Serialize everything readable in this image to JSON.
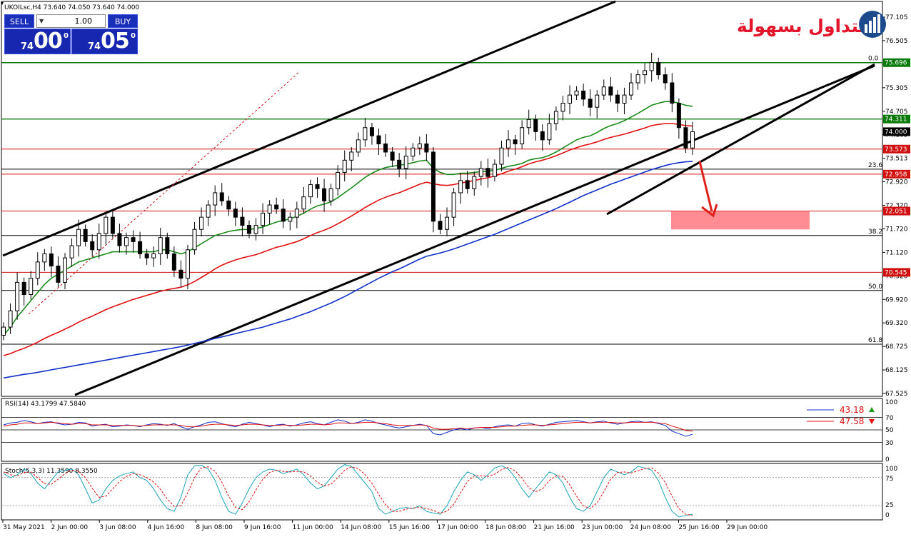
{
  "header": {
    "symbol_title": "UKOILsc,H4  73.640 74.050 73.640 74.000"
  },
  "trade_panel": {
    "sell_label": "SELL",
    "buy_label": "BUY",
    "lot_value": "1.00",
    "bid_small": "74",
    "bid_big": "00",
    "bid_sup": "0",
    "ask_small": "74",
    "ask_big": "05",
    "ask_sup": "0"
  },
  "logo": {
    "text": "التداول بسهولة"
  },
  "colors": {
    "bull_candle": "#ffffff",
    "bear_candle": "#000000",
    "ma_green": "#1a8a1a",
    "ma_red": "#e01010",
    "ma_blue": "#1030c8",
    "level_red": "#d01010",
    "level_green": "#0a7a0a",
    "target_zone": "#ff7f86",
    "arrow": "#e0201a"
  },
  "chart_data": [
    {
      "type": "candlestick",
      "title": "UKOILsc,H4  73.640 74.050 73.640 74.000",
      "ylim": [
        67.5,
        77.2
      ],
      "y_ticks": [
        "77.105",
        "76.505",
        "75.905",
        "75.305",
        "74.705",
        "74.105",
        "73.513",
        "72.920",
        "72.320",
        "71.720",
        "71.120",
        "70.520",
        "69.920",
        "69.320",
        "68.725",
        "68.125",
        "67.525"
      ],
      "x_ticks": [
        "31 May 2021",
        "2 Jun 00:00",
        "3 Jun 08:00",
        "4 Jun 16:00",
        "8 Jun 08:00",
        "9 Jun 16:00",
        "11 Jun 00:00",
        "14 Jun 08:00",
        "15 Jun 16:00",
        "17 Jun 00:00",
        "18 Jun 08:00",
        "21 Jun 16:00",
        "23 Jun 00:00",
        "24 Jun 08:00",
        "25 Jun 16:00",
        "29 Jun 00:00"
      ],
      "last_price": 74.0,
      "close": [
        69.2,
        69.6,
        70.3,
        70.0,
        70.4,
        70.8,
        71.0,
        70.7,
        70.3,
        70.9,
        71.2,
        71.6,
        71.3,
        71.1,
        71.5,
        71.9,
        71.5,
        71.2,
        71.4,
        71.3,
        71.0,
        70.9,
        71.0,
        71.4,
        71.0,
        70.6,
        70.4,
        71.1,
        71.6,
        71.9,
        72.2,
        72.5,
        72.3,
        72.1,
        71.9,
        71.7,
        71.5,
        71.7,
        72.0,
        72.2,
        72.1,
        71.8,
        71.9,
        72.1,
        72.4,
        72.7,
        72.6,
        72.3,
        72.6,
        73.0,
        73.3,
        73.5,
        73.8,
        74.1,
        73.9,
        73.7,
        73.5,
        73.3,
        73.1,
        73.4,
        73.6,
        73.7,
        73.5,
        71.8,
        71.6,
        71.9,
        72.5,
        72.8,
        72.6,
        72.9,
        73.1,
        72.9,
        73.2,
        73.6,
        73.8,
        73.7,
        74.1,
        74.3,
        74.0,
        73.8,
        74.2,
        74.5,
        74.7,
        74.9,
        75.0,
        74.8,
        74.6,
        74.9,
        75.1,
        74.9,
        74.7,
        74.9,
        75.2,
        75.4,
        75.5,
        75.7,
        75.4,
        75.2,
        74.7,
        74.1,
        73.6,
        74.0
      ],
      "series": [
        {
          "name": "",
          "role": "ma-green",
          "values": [
            69.0,
            69.2,
            69.45,
            69.65,
            69.85,
            70.05,
            70.25,
            70.4,
            70.5,
            70.6,
            70.7,
            70.8,
            70.85,
            70.9,
            70.95,
            71.0,
            71.05,
            71.05,
            71.05,
            71.05,
            71.05,
            71.05,
            71.05,
            71.1,
            71.1,
            71.05,
            71.0,
            71.05,
            71.15,
            71.25,
            71.35,
            71.45,
            71.5,
            71.55,
            71.58,
            71.6,
            71.6,
            71.62,
            71.66,
            71.72,
            71.78,
            71.82,
            71.86,
            71.92,
            72.0,
            72.1,
            72.18,
            72.22,
            72.28,
            72.38,
            72.5,
            72.62,
            72.75,
            72.88,
            72.98,
            73.06,
            73.12,
            73.15,
            73.18,
            73.2,
            73.24,
            73.28,
            73.3,
            73.1,
            73.0,
            72.95,
            72.95,
            72.98,
            72.98,
            73.0,
            73.02,
            73.03,
            73.05,
            73.1,
            73.15,
            73.18,
            73.22,
            73.3,
            73.34,
            73.36,
            73.42,
            73.5,
            73.6,
            73.7,
            73.8,
            73.86,
            73.9,
            73.98,
            74.08,
            74.15,
            74.2,
            74.27,
            74.36,
            74.45,
            74.55,
            74.65,
            74.7,
            74.74,
            74.74,
            74.7,
            74.65,
            74.62
          ]
        },
        {
          "name": "",
          "role": "ma-red",
          "values": [
            68.5,
            68.55,
            68.62,
            68.68,
            68.75,
            68.83,
            68.92,
            69.0,
            69.07,
            69.15,
            69.23,
            69.32,
            69.4,
            69.47,
            69.55,
            69.63,
            69.7,
            69.76,
            69.82,
            69.88,
            69.93,
            69.98,
            70.03,
            70.08,
            70.12,
            70.15,
            70.18,
            70.24,
            70.32,
            70.42,
            70.52,
            70.63,
            70.72,
            70.79,
            70.85,
            70.9,
            70.94,
            70.98,
            71.04,
            71.1,
            71.16,
            71.2,
            71.25,
            71.3,
            71.37,
            71.45,
            71.52,
            71.58,
            71.65,
            71.74,
            71.83,
            71.93,
            72.03,
            72.14,
            72.23,
            72.32,
            72.39,
            72.45,
            72.5,
            72.57,
            72.64,
            72.71,
            72.76,
            72.72,
            72.69,
            72.68,
            72.7,
            72.74,
            72.77,
            72.8,
            72.84,
            72.87,
            72.91,
            72.97,
            73.03,
            73.08,
            73.14,
            73.21,
            73.26,
            73.3,
            73.35,
            73.41,
            73.48,
            73.55,
            73.61,
            73.66,
            73.7,
            73.75,
            73.81,
            73.86,
            73.9,
            73.94,
            73.99,
            74.04,
            74.09,
            74.15,
            74.18,
            74.2,
            74.2,
            74.18,
            74.15,
            74.14
          ]
        },
        {
          "name": "",
          "role": "ma-blue",
          "values": [
            67.95,
            67.98,
            68.01,
            68.04,
            68.06,
            68.09,
            68.12,
            68.15,
            68.18,
            68.21,
            68.24,
            68.27,
            68.3,
            68.33,
            68.36,
            68.39,
            68.42,
            68.45,
            68.48,
            68.51,
            68.54,
            68.57,
            68.6,
            68.63,
            68.66,
            68.69,
            68.72,
            68.76,
            68.8,
            68.84,
            68.88,
            68.92,
            68.96,
            69.0,
            69.04,
            69.08,
            69.12,
            69.16,
            69.2,
            69.25,
            69.3,
            69.35,
            69.4,
            69.46,
            69.52,
            69.58,
            69.65,
            69.72,
            69.79,
            69.87,
            69.95,
            70.04,
            70.13,
            70.22,
            70.31,
            70.4,
            70.48,
            70.56,
            70.63,
            70.71,
            70.79,
            70.87,
            70.94,
            70.98,
            71.02,
            71.07,
            71.12,
            71.18,
            71.24,
            71.3,
            71.36,
            71.42,
            71.48,
            71.55,
            71.62,
            71.69,
            71.76,
            71.83,
            71.9,
            71.97,
            72.04,
            72.11,
            72.19,
            72.27,
            72.35,
            72.43,
            72.5,
            72.57,
            72.64,
            72.71,
            72.77,
            72.83,
            72.89,
            72.95,
            73.01,
            73.07,
            73.12,
            73.17,
            73.21,
            73.24,
            73.26,
            73.27
          ]
        }
      ],
      "horizontal_levels": [
        {
          "value": 75.696,
          "label": "75.696",
          "kind": "green-level"
        },
        {
          "value": 74.311,
          "label": "74.311",
          "kind": "green-level"
        },
        {
          "value": 73.573,
          "label": "73.573",
          "kind": "red-level"
        },
        {
          "value": 72.958,
          "label": "72.958",
          "kind": "red-level"
        },
        {
          "value": 72.051,
          "label": "72.051",
          "kind": "red-level"
        },
        {
          "value": 70.545,
          "label": "70.545",
          "kind": "red-level"
        }
      ],
      "fibonacci": [
        {
          "label": "0.0",
          "value": 75.7
        },
        {
          "label": "23.6",
          "value": 73.08
        },
        {
          "label": "38.2",
          "value": 71.45
        },
        {
          "label": "50.0",
          "value": 70.1
        },
        {
          "label": "61.8",
          "value": 68.78
        }
      ],
      "target_zone": {
        "from": 71.6,
        "to": 72.05
      }
    },
    {
      "type": "line",
      "title": "RSI(14) 43.1799 47.5840",
      "ylim": [
        0,
        100
      ],
      "y_ticks": [
        "100",
        "70",
        "50",
        "30",
        "0"
      ],
      "legend": [
        {
          "label": "43.18",
          "direction": "up"
        },
        {
          "label": "47.58",
          "direction": "down"
        }
      ],
      "series": [
        {
          "name": "43.18",
          "values": [
            58,
            61,
            62,
            65,
            63,
            60,
            62,
            63,
            60,
            58,
            59,
            62,
            61,
            56,
            58,
            59,
            55,
            56,
            58,
            57,
            55,
            58,
            60,
            59,
            57,
            60,
            55,
            51,
            55,
            58,
            62,
            63,
            60,
            57,
            55,
            59,
            62,
            60,
            58,
            55,
            58,
            59,
            56,
            58,
            61,
            63,
            60,
            58,
            62,
            66,
            64,
            60,
            62,
            66,
            64,
            60,
            58,
            55,
            53,
            55,
            57,
            59,
            57,
            44,
            42,
            46,
            50,
            52,
            50,
            53,
            54,
            52,
            55,
            57,
            58,
            56,
            60,
            61,
            58,
            56,
            59,
            62,
            63,
            64,
            65,
            63,
            61,
            63,
            64,
            61,
            59,
            61,
            63,
            64,
            62,
            63,
            60,
            57,
            48,
            44,
            40,
            43
          ]
        },
        {
          "name": "47.58",
          "values": [
            56,
            58,
            59,
            61,
            61,
            60,
            61,
            62,
            61,
            60,
            59,
            60,
            60,
            58,
            58,
            58,
            57,
            57,
            57,
            57,
            56,
            57,
            58,
            58,
            58,
            58,
            57,
            55,
            55,
            56,
            58,
            59,
            59,
            58,
            57,
            58,
            59,
            59,
            58,
            57,
            57,
            58,
            57,
            57,
            58,
            59,
            59,
            58,
            59,
            61,
            61,
            60,
            61,
            62,
            62,
            61,
            60,
            58,
            57,
            57,
            57,
            58,
            57,
            53,
            51,
            51,
            52,
            53,
            52,
            53,
            54,
            54,
            54,
            55,
            56,
            56,
            57,
            58,
            58,
            57,
            58,
            59,
            60,
            61,
            62,
            62,
            61,
            62,
            62,
            62,
            61,
            61,
            62,
            62,
            62,
            62,
            61,
            60,
            56,
            53,
            49,
            48
          ]
        }
      ]
    },
    {
      "type": "line",
      "title": "Stoch(5,3,3) 11.3590 8.3550",
      "ylim": [
        0,
        100
      ],
      "y_ticks": [
        "100",
        "75",
        "25",
        "0"
      ],
      "series": [
        {
          "name": "",
          "values": [
            82,
            75,
            80,
            90,
            82,
            65,
            55,
            70,
            85,
            88,
            90,
            80,
            55,
            30,
            35,
            55,
            70,
            78,
            82,
            85,
            75,
            70,
            55,
            35,
            20,
            15,
            40,
            80,
            96,
            97,
            90,
            70,
            40,
            15,
            10,
            30,
            55,
            75,
            85,
            90,
            88,
            82,
            86,
            90,
            80,
            65,
            55,
            60,
            75,
            90,
            98,
            95,
            80,
            65,
            50,
            20,
            10,
            15,
            20,
            22,
            20,
            25,
            15,
            12,
            10,
            25,
            50,
            70,
            85,
            80,
            70,
            80,
            92,
            96,
            90,
            75,
            55,
            40,
            55,
            70,
            85,
            80,
            65,
            40,
            20,
            15,
            25,
            50,
            75,
            90,
            85,
            80,
            85,
            95,
            92,
            88,
            70,
            40,
            15,
            5,
            8,
            10
          ]
        },
        {
          "name": "",
          "values": [
            85,
            80,
            78,
            84,
            85,
            75,
            64,
            63,
            72,
            82,
            88,
            86,
            75,
            56,
            40,
            42,
            55,
            68,
            77,
            82,
            80,
            75,
            67,
            54,
            37,
            24,
            25,
            48,
            75,
            92,
            94,
            86,
            67,
            42,
            22,
            18,
            32,
            53,
            72,
            84,
            88,
            86,
            85,
            86,
            85,
            78,
            67,
            60,
            63,
            75,
            88,
            94,
            91,
            80,
            65,
            45,
            27,
            15,
            15,
            19,
            21,
            22,
            20,
            17,
            12,
            15,
            28,
            48,
            68,
            78,
            78,
            77,
            81,
            89,
            93,
            87,
            74,
            57,
            50,
            55,
            70,
            78,
            77,
            62,
            42,
            25,
            20,
            30,
            50,
            72,
            84,
            85,
            83,
            87,
            91,
            92,
            83,
            66,
            42,
            20,
            10,
            8
          ]
        }
      ]
    }
  ]
}
